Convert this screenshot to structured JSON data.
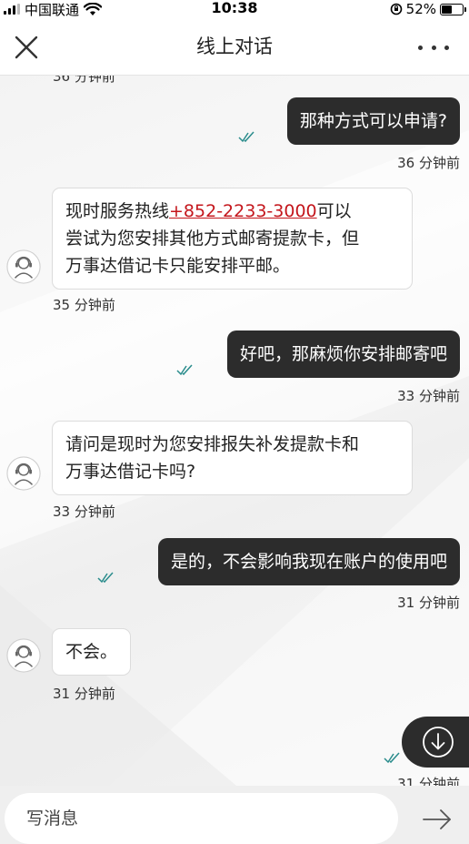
{
  "status_bar": {
    "carrier": "中国联通",
    "time": "10:38",
    "battery_pct": "52%",
    "battery_level": 0.52,
    "icons": [
      "signal-bars-icon",
      "wifi-icon",
      "rotation-lock-icon",
      "battery-icon"
    ]
  },
  "header": {
    "title": "线上对话",
    "close_icon": "close-icon",
    "more_icon": "more-dots-icon"
  },
  "messages": [
    {
      "type": "timestamp_partial",
      "time": "36 分钟前"
    },
    {
      "type": "out",
      "text": "那种方式可以申请?",
      "time": "36 分钟前",
      "read": true
    },
    {
      "type": "in",
      "text_before_link": "现时服务热线",
      "link": "+852-2233-3000",
      "text_after_link_line1": "可以",
      "line2": "尝试为您安排其他方式邮寄提款卡，但",
      "line3": "万事达借记卡只能安排平邮。",
      "time": "35 分钟前"
    },
    {
      "type": "out",
      "text": "好吧，那麻烦你安排邮寄吧",
      "time": "33 分钟前",
      "read": true
    },
    {
      "type": "in",
      "line1": "请问是现时为您安排报失补发提款卡和",
      "line2": "万事达借记卡吗?",
      "time": "33 分钟前"
    },
    {
      "type": "out",
      "text": "是的，不会影响我现在账户的使用吧",
      "time": "31 分钟前",
      "read": true
    },
    {
      "type": "in",
      "line1": "不会。",
      "time": "31 分钟前"
    },
    {
      "type": "out_partial",
      "time": "31 分钟前",
      "read": true
    }
  ],
  "scroll_down_icon": "arrow-down-circle-icon",
  "input": {
    "placeholder": "写消息",
    "value": ""
  },
  "send_icon": "arrow-right-icon",
  "colors": {
    "outgoing_bubble": "#2c2c2c",
    "link": "#c4161c",
    "read_tick": "#2a8c8c"
  }
}
